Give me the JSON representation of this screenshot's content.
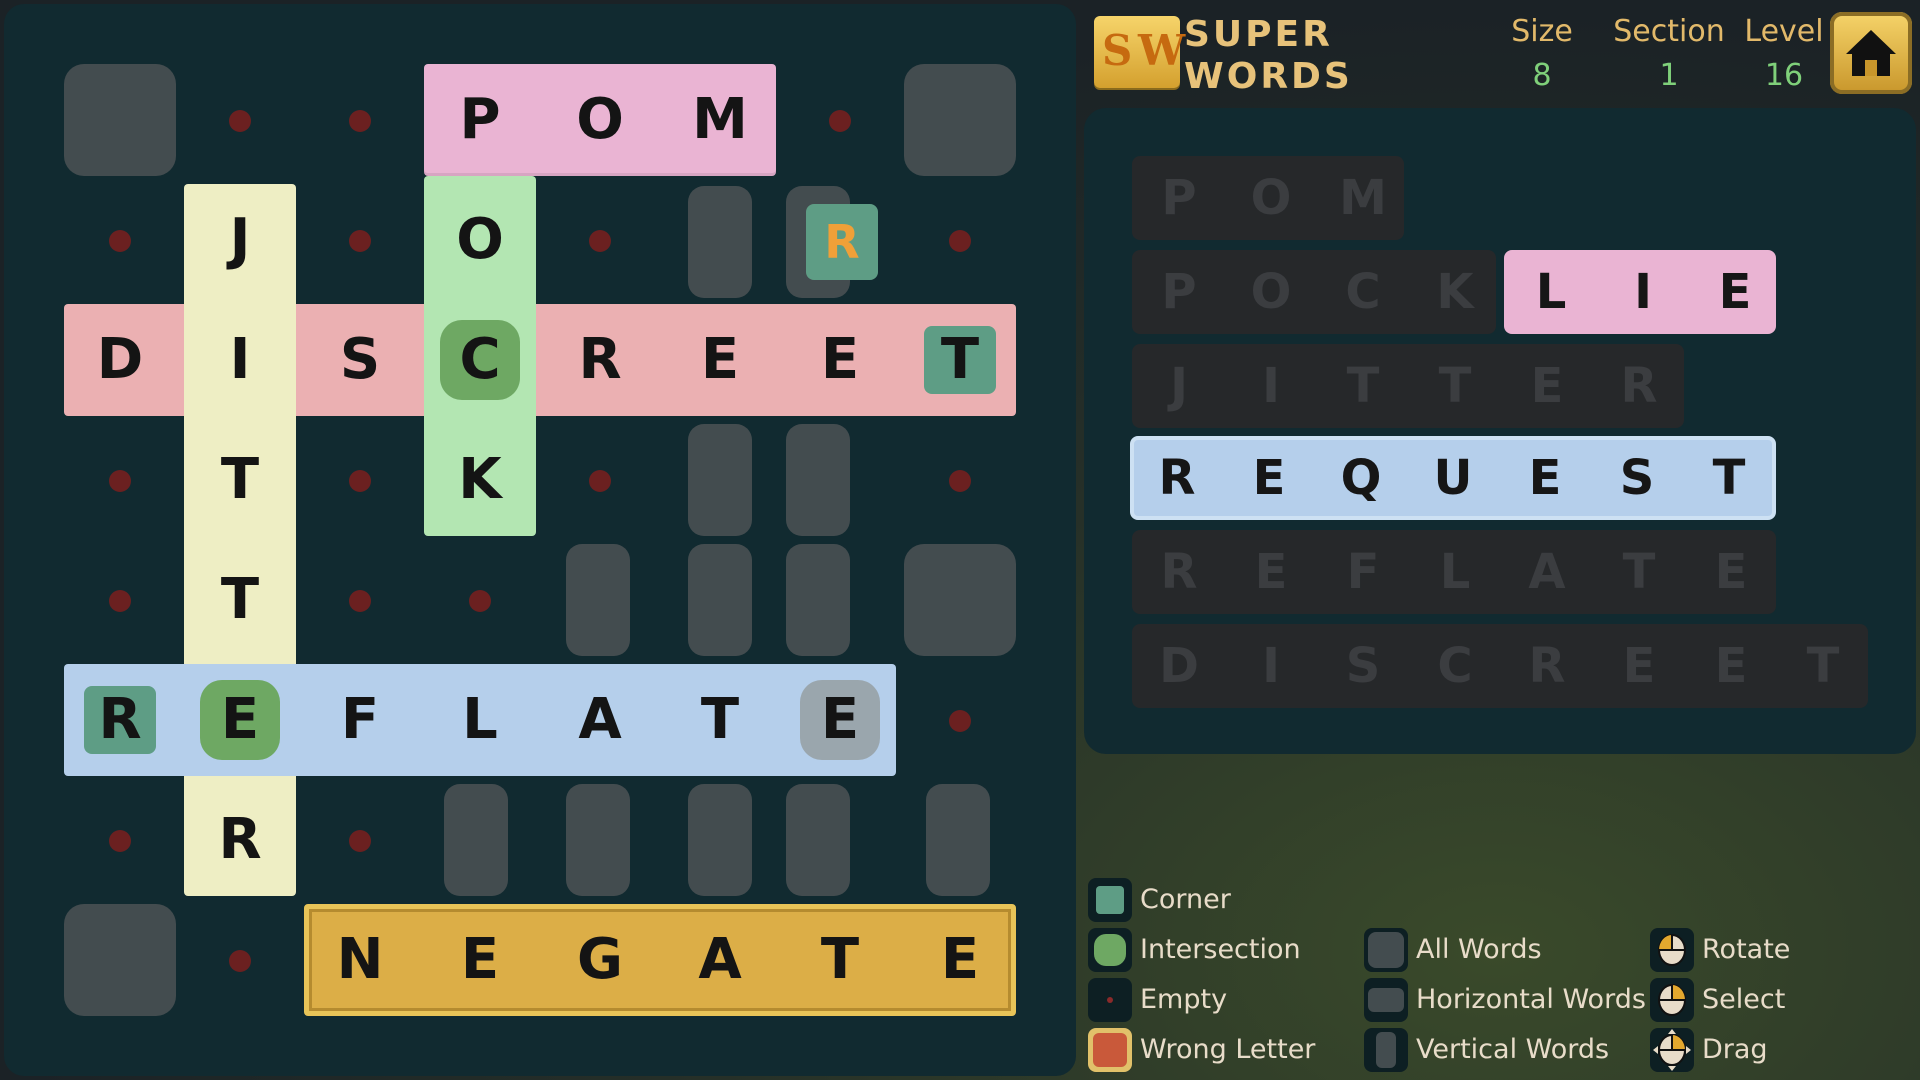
{
  "header": {
    "logo_letters": [
      "S",
      "W"
    ],
    "logo_line1": "SUPER",
    "logo_line2": "WORDS",
    "size_label": "Size",
    "size_value": "8",
    "section_label": "Section",
    "section_value": "1",
    "level_label": "Level",
    "level_value": "16",
    "home_icon": "home-icon"
  },
  "board": {
    "words": {
      "pom": [
        "P",
        "O",
        "M"
      ],
      "pock": [
        "O",
        "C",
        "K"
      ],
      "jitter": [
        "J",
        "I",
        "T",
        "T",
        "E",
        "R"
      ],
      "discreet": [
        "D",
        "I",
        "S",
        "C",
        "R",
        "E",
        "E",
        "T"
      ],
      "reflate": [
        "R",
        "E",
        "F",
        "L",
        "A",
        "T",
        "E"
      ],
      "negate": [
        "N",
        "E",
        "G",
        "A",
        "T",
        "E"
      ]
    },
    "floating_letter": "R"
  },
  "word_list": [
    {
      "letters": [
        "P",
        "O",
        "M"
      ],
      "state": "unplaced"
    },
    {
      "letters": [
        "P",
        "O",
        "C",
        "K"
      ],
      "state": "unplaced"
    },
    {
      "letters": [
        "L",
        "I",
        "E"
      ],
      "state": "highlighted"
    },
    {
      "letters": [
        "J",
        "I",
        "T",
        "T",
        "E",
        "R"
      ],
      "state": "unplaced"
    },
    {
      "letters": [
        "R",
        "E",
        "Q",
        "U",
        "E",
        "S",
        "T"
      ],
      "state": "selected"
    },
    {
      "letters": [
        "R",
        "E",
        "F",
        "L",
        "A",
        "T",
        "E"
      ],
      "state": "unplaced"
    },
    {
      "letters": [
        "D",
        "I",
        "S",
        "C",
        "R",
        "E",
        "E",
        "T"
      ],
      "state": "unplaced"
    }
  ],
  "legend": {
    "corner": "Corner",
    "intersection": "Intersection",
    "empty": "Empty",
    "wrong_letter": "Wrong Letter",
    "all_words": "All Words",
    "horizontal_words": "Horizontal Words",
    "vertical_words": "Vertical Words",
    "rotate": "Rotate",
    "select": "Select",
    "drag": "Drag"
  },
  "colors": {
    "board_bg": "#112a30",
    "corner": "#5e9d85",
    "intersection": "#6ea863",
    "empty_dot": "#6b2020",
    "wrong_letter": "#c9593a",
    "accent_gold": "#dcae47"
  }
}
